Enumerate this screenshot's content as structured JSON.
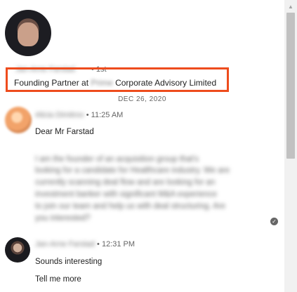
{
  "profile": {
    "name": "Jan-Arne Farstad",
    "degree": "• 1st",
    "headline_prefix": "Founding Partner at ",
    "headline_blurred": "Prime",
    "headline_suffix": " Corporate Advisory Limited"
  },
  "date_separator": "DEC 26, 2020",
  "messages": [
    {
      "sender": "Alicia Dimitrov",
      "time": "• 11:25 AM",
      "greeting": "Dear Mr Farstad",
      "blurred_lines": [
        "I am the founder of an acquisition group that's",
        "looking for a candidate for Healthcare industry. We are",
        "currently scanning deal flow and are looking for an",
        "investment banker with significant M&A experience",
        "to join our team and help us with deal structuring. Are",
        "you interested?"
      ]
    },
    {
      "sender": "Jan-Arne Farstad",
      "time": "• 12:31 PM",
      "lines": [
        "Sounds interesting",
        "Tell me more"
      ]
    }
  ],
  "icons": {
    "read_receipt": "check-circle-icon",
    "scroll_up": "triangle-up-icon"
  }
}
